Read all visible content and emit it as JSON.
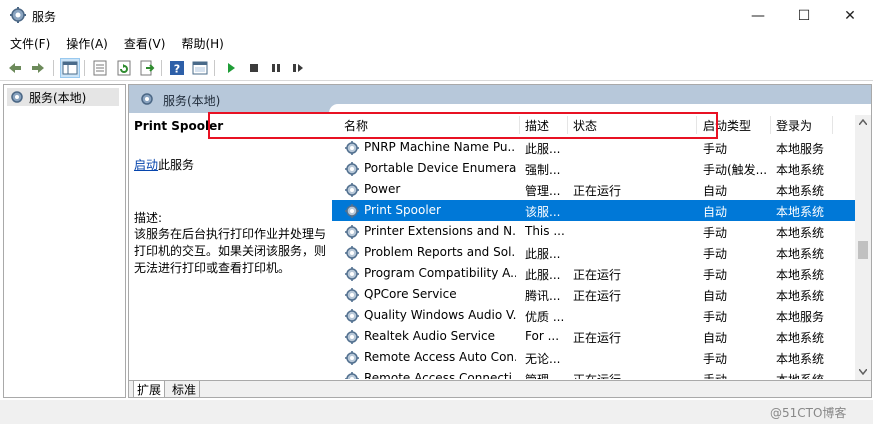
{
  "window": {
    "title": "服务",
    "min_glyph": "—",
    "max_glyph": "☐",
    "close_glyph": "✕"
  },
  "menu": [
    "文件(F)",
    "操作(A)",
    "查看(V)",
    "帮助(H)"
  ],
  "toolbar": {
    "icons": [
      "back-icon",
      "forward-icon",
      "show-tree-icon",
      "properties-icon",
      "refresh-icon",
      "export-icon",
      "help-icon",
      "console-icon",
      "start-icon",
      "stop-icon",
      "pause-icon",
      "restart-icon"
    ]
  },
  "tree": {
    "label": "服务(本地)"
  },
  "pane": {
    "title": "服务(本地)"
  },
  "description": {
    "service_name": "Print Spooler",
    "start_link": "启动",
    "start_suffix": "此服务",
    "label": "描述:",
    "text": "该服务在后台执行打印作业并处理与打印机的交互。如果关闭该服务，则无法进行打印或查看打印机。"
  },
  "columns": {
    "name": "名称",
    "desc": "描述",
    "status": "状态",
    "startup": "启动类型",
    "logon": "登录为",
    "sort_arrow": "^"
  },
  "rows": [
    {
      "name": "PNRP Machine Name Pu...",
      "desc": "此服...",
      "status": "",
      "startup": "手动",
      "logon": "本地服务"
    },
    {
      "name": "Portable Device Enumera...",
      "desc": "强制...",
      "status": "",
      "startup": "手动(触发...",
      "logon": "本地系统"
    },
    {
      "name": "Power",
      "desc": "管理...",
      "status": "正在运行",
      "startup": "自动",
      "logon": "本地系统"
    },
    {
      "name": "Print Spooler",
      "desc": "该服...",
      "status": "",
      "startup": "自动",
      "logon": "本地系统",
      "selected": true
    },
    {
      "name": "Printer Extensions and N...",
      "desc": "This ...",
      "status": "",
      "startup": "手动",
      "logon": "本地系统"
    },
    {
      "name": "Problem Reports and Sol...",
      "desc": "此服...",
      "status": "",
      "startup": "手动",
      "logon": "本地系统"
    },
    {
      "name": "Program Compatibility A...",
      "desc": "此服...",
      "status": "正在运行",
      "startup": "手动",
      "logon": "本地系统"
    },
    {
      "name": "QPCore Service",
      "desc": "腾讯...",
      "status": "正在运行",
      "startup": "自动",
      "logon": "本地系统"
    },
    {
      "name": "Quality Windows Audio V...",
      "desc": "优质 ...",
      "status": "",
      "startup": "手动",
      "logon": "本地服务"
    },
    {
      "name": "Realtek Audio Service",
      "desc": "For ...",
      "status": "正在运行",
      "startup": "自动",
      "logon": "本地系统"
    },
    {
      "name": "Remote Access Auto Con...",
      "desc": "无论...",
      "status": "",
      "startup": "手动",
      "logon": "本地系统"
    },
    {
      "name": "Remote Access Connecti...",
      "desc": "管理...",
      "status": "正在运行",
      "startup": "手动",
      "logon": "本地系统"
    }
  ],
  "tabs": [
    "扩展",
    "标准"
  ],
  "watermark": "@51CTO博客",
  "colors": {
    "selection": "#0078d7",
    "header": "#b7c8da",
    "highlight": "#e81123"
  }
}
